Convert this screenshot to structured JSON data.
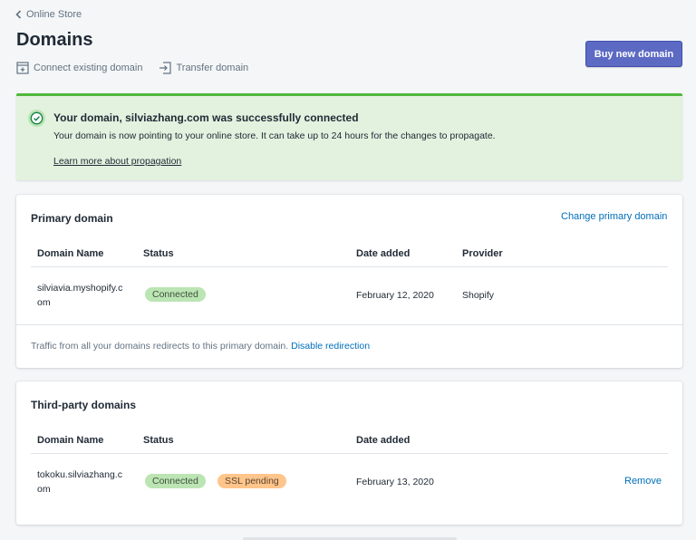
{
  "breadcrumb": {
    "label": "Online Store"
  },
  "page": {
    "title": "Domains"
  },
  "actions": {
    "connect_existing": "Connect existing domain",
    "transfer": "Transfer domain"
  },
  "buy_button": {
    "label": "Buy new domain"
  },
  "banner": {
    "title": "Your domain, silviazhang.com was successfully connected",
    "text": "Your domain is now pointing to your online store. It can take up to 24 hours for the changes to propagate.",
    "link": "Learn more about propagation"
  },
  "primary": {
    "title": "Primary domain",
    "change_link": "Change primary domain",
    "headers": {
      "name": "Domain Name",
      "status": "Status",
      "date": "Date added",
      "provider": "Provider"
    },
    "row": {
      "name_line1": "silviavia.myshopify.c",
      "name_line2": "om",
      "status": "Connected",
      "date": "February 12, 2020",
      "provider": "Shopify"
    },
    "footer_text": "Traffic from all your domains redirects to this primary domain.",
    "footer_link": "Disable redirection"
  },
  "third_party": {
    "title": "Third-party domains",
    "headers": {
      "name": "Domain Name",
      "status": "Status",
      "date": "Date added"
    },
    "row": {
      "name_line1": "tokoku.silviazhang.c",
      "name_line2": "om",
      "status": "Connected",
      "ssl": "SSL pending",
      "date": "February 13, 2020",
      "remove": "Remove"
    }
  },
  "colors": {
    "accent": "#5c6ac4",
    "success": "#50b83c",
    "link": "#006fbb",
    "badge_success": "#bbe5b3",
    "badge_warning": "#ffc58b"
  },
  "icons": [
    "chevron-left-icon",
    "connect-domain-icon",
    "transfer-domain-icon",
    "checkmark-circle-icon"
  ]
}
